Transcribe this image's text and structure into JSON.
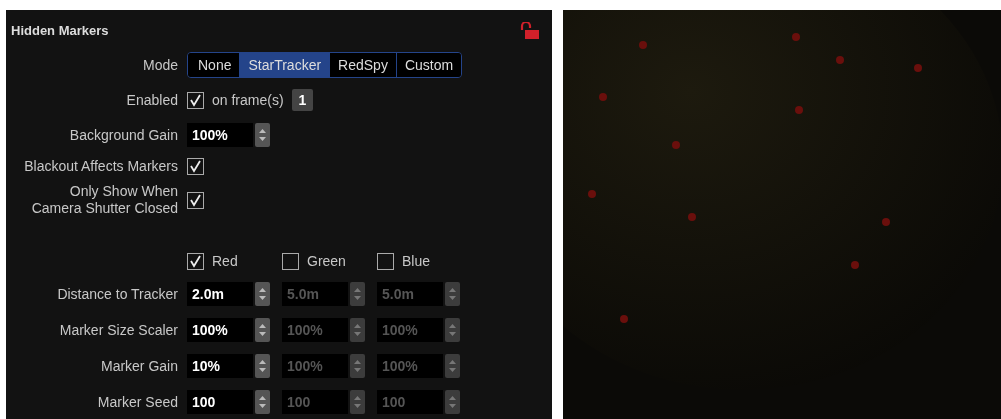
{
  "panel": {
    "title": "Hidden Markers",
    "locked": false
  },
  "mode": {
    "label": "Mode",
    "options": [
      {
        "label": "None",
        "selected": false
      },
      {
        "label": "StarTracker",
        "selected": true
      },
      {
        "label": "RedSpy",
        "selected": false
      },
      {
        "label": "Custom",
        "selected": false
      }
    ]
  },
  "enabled": {
    "label": "Enabled",
    "checked": true,
    "suffix": "on frame(s)",
    "frame": "1"
  },
  "background_gain": {
    "label": "Background Gain",
    "value": "100%"
  },
  "blackout_affects_markers": {
    "label": "Blackout Affects Markers",
    "checked": true
  },
  "only_show_when_shutter_closed": {
    "label": "Only Show When Camera Shutter Closed",
    "checked": true
  },
  "channels": [
    {
      "label": "Red",
      "checked": true
    },
    {
      "label": "Green",
      "checked": false
    },
    {
      "label": "Blue",
      "checked": false
    }
  ],
  "rows": [
    {
      "label": "Distance to Tracker",
      "values": [
        {
          "value": "2.0m",
          "disabled": false
        },
        {
          "value": "5.0m",
          "disabled": true
        },
        {
          "value": "5.0m",
          "disabled": true
        }
      ]
    },
    {
      "label": "Marker Size Scaler",
      "values": [
        {
          "value": "100%",
          "disabled": false
        },
        {
          "value": "100%",
          "disabled": true
        },
        {
          "value": "100%",
          "disabled": true
        }
      ]
    },
    {
      "label": "Marker Gain",
      "values": [
        {
          "value": "10%",
          "disabled": false
        },
        {
          "value": "100%",
          "disabled": true
        },
        {
          "value": "100%",
          "disabled": true
        }
      ]
    },
    {
      "label": "Marker Seed",
      "values": [
        {
          "value": "100",
          "disabled": false
        },
        {
          "value": "100",
          "disabled": true
        },
        {
          "value": "100",
          "disabled": true
        }
      ]
    }
  ]
}
